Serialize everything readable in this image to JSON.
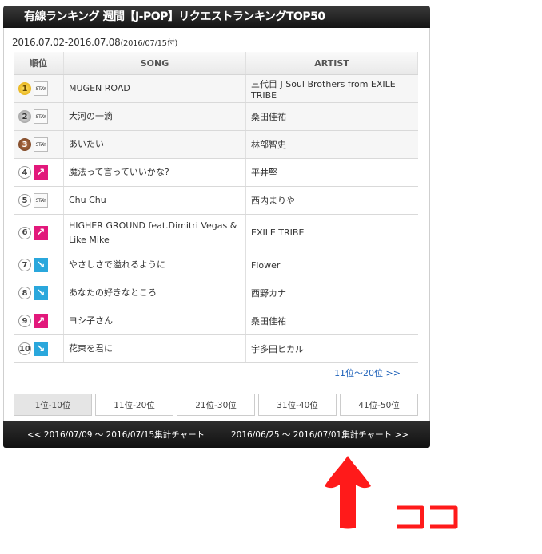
{
  "header": {
    "title": "有線ランキング 週間【J-POP】リクエストランキングTOP50"
  },
  "period": {
    "range": "2016.07.02-2016.07.08",
    "updated": "(2016/07/15付)"
  },
  "table": {
    "headers": {
      "rank": "順位",
      "song": "SONG",
      "artist": "ARTIST"
    },
    "rows": [
      {
        "rank": "1",
        "trend": "STAY",
        "song": "MUGEN ROAD",
        "artist": "三代目 J Soul Brothers from EXILE TRIBE"
      },
      {
        "rank": "2",
        "trend": "STAY",
        "song": "大河の一滴",
        "artist": "桑田佳祐"
      },
      {
        "rank": "3",
        "trend": "STAY",
        "song": "あいたい",
        "artist": "林部智史"
      },
      {
        "rank": "4",
        "trend": "up",
        "song": "魔法って言っていいかな?",
        "artist": "平井堅"
      },
      {
        "rank": "5",
        "trend": "STAY",
        "song": "Chu Chu",
        "artist": "西内まりや"
      },
      {
        "rank": "6",
        "trend": "up",
        "song": "HIGHER GROUND feat.Dimitri Vegas & Like Mike",
        "artist": "EXILE TRIBE"
      },
      {
        "rank": "7",
        "trend": "down",
        "song": "やさしさで溢れるように",
        "artist": "Flower"
      },
      {
        "rank": "8",
        "trend": "down",
        "song": "あなたの好きなところ",
        "artist": "西野カナ"
      },
      {
        "rank": "9",
        "trend": "up",
        "song": "ヨシ子さん",
        "artist": "桑田佳祐"
      },
      {
        "rank": "10",
        "trend": "down",
        "song": "花束を君に",
        "artist": "宇多田ヒカル"
      }
    ]
  },
  "next_link": "11位〜20位 >>",
  "tabs": [
    "1位-10位",
    "11位-20位",
    "21位-30位",
    "31位-40位",
    "41位-50位"
  ],
  "footer": {
    "prev": "<< 2016/07/09 〜 2016/07/15集計チャート",
    "next": "2016/06/25 〜 2016/07/01集計チャート >>"
  },
  "annotation": {
    "text": "ココ",
    "color": "#ff1a1a"
  },
  "colors": {
    "up": "#e2187b",
    "down": "#2aa7dc",
    "link": "#1b5fb8"
  }
}
